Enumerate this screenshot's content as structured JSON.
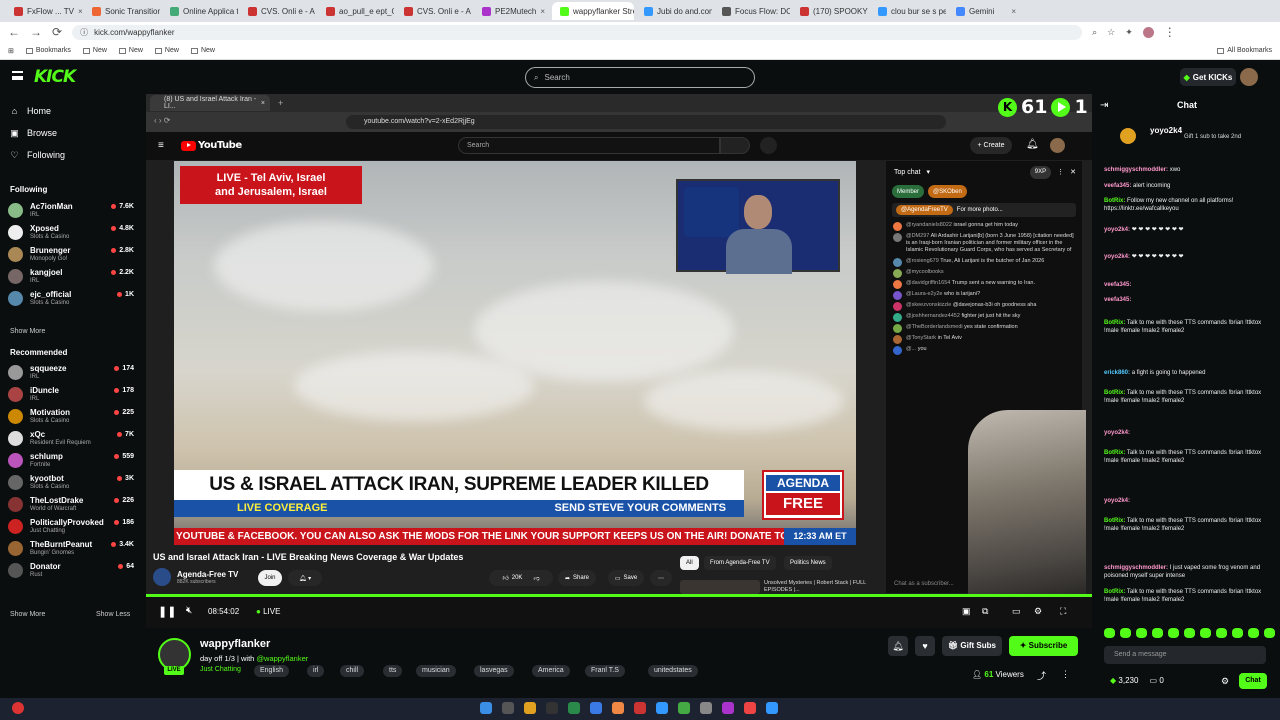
{
  "browser": {
    "tabs": [
      {
        "label": "FxFlow ... TV",
        "color": "#c33"
      },
      {
        "label": "Sonic Transition Cl...",
        "color": "#e63"
      },
      {
        "label": "Online Applica tion",
        "color": "#4a7"
      },
      {
        "label": "CVS. Onli e - A pli ...",
        "color": "#c33"
      },
      {
        "label": "ao_pull_e ept_OD...",
        "color": "#c33"
      },
      {
        "label": "CVS. Onli e - A pli ...",
        "color": "#c33"
      },
      {
        "label": "PE2Mutech",
        "color": "#a3c"
      },
      {
        "label": "wappyflanker Strea...",
        "color": "#53fc18"
      },
      {
        "label": "Jubi do and.com",
        "color": "#39f"
      },
      {
        "label": "Focus Flow: DC | Sm...",
        "color": "#555"
      },
      {
        "label": "(170) SPOOKY 4 ...",
        "color": "#c33"
      },
      {
        "label": "clou bur se s pe",
        "color": "#39f"
      },
      {
        "label": "Gemini",
        "color": "#48f"
      }
    ],
    "url": "kick.com/wappyflanker",
    "bookmarks": [
      "Bookmarks",
      "New",
      "New",
      "New",
      "New",
      "All Bookmarks"
    ]
  },
  "kick": {
    "logo": "KICK",
    "search_placeholder": "Search",
    "get_kicks": "Get KICKs"
  },
  "sidebar": {
    "nav": [
      {
        "label": "Home",
        "icon": "⌂"
      },
      {
        "label": "Browse",
        "icon": "▣"
      },
      {
        "label": "Following",
        "icon": "♡"
      }
    ],
    "following_title": "Following",
    "following": [
      {
        "name": "Ac7ionMan",
        "game": "IRL",
        "viewers": "7.6K",
        "color": "#8b8"
      },
      {
        "name": "Xposed",
        "game": "Slots & Casino",
        "viewers": "4.8K",
        "color": "#eee"
      },
      {
        "name": "Brunenger",
        "game": "Monopoly Go!",
        "viewers": "2.8K",
        "color": "#a85"
      },
      {
        "name": "kangjoel",
        "game": "IRL",
        "viewers": "2.2K",
        "color": "#766"
      },
      {
        "name": "ejc_official",
        "game": "Slots & Casino",
        "viewers": "1K",
        "color": "#58a"
      }
    ],
    "show_more": "Show More",
    "recommended_title": "Recommended",
    "recommended": [
      {
        "name": "sqqueeze",
        "game": "IRL",
        "viewers": "174",
        "color": "#999"
      },
      {
        "name": "iDuncle",
        "game": "IRL",
        "viewers": "178",
        "color": "#a44"
      },
      {
        "name": "Motivation",
        "game": "Slots & Casino",
        "viewers": "225",
        "color": "#c80"
      },
      {
        "name": "xQc",
        "game": "Resident Evil Requiem",
        "viewers": "7K",
        "color": "#ddd"
      },
      {
        "name": "schlump",
        "game": "Fortnite",
        "viewers": "559",
        "color": "#b5b"
      },
      {
        "name": "kyootbot",
        "game": "Slots & Casino",
        "viewers": "3K",
        "color": "#666"
      },
      {
        "name": "TheLostDrake",
        "game": "World of Warcraft",
        "viewers": "226",
        "color": "#833"
      },
      {
        "name": "PoliticallyProvoked",
        "game": "Just Chatting",
        "viewers": "186",
        "color": "#c22"
      },
      {
        "name": "TheBurntPeanut",
        "game": "Bungin' Gnomes",
        "viewers": "3.4K",
        "color": "#963"
      },
      {
        "name": "Donator",
        "game": "Rust",
        "viewers": "64",
        "color": "#555"
      }
    ],
    "show_more_2": "Show More",
    "show_less": "Show Less"
  },
  "inner_browser": {
    "tab": "(8) US and Israel Attack Iran - LI...",
    "url": "youtube.com/watch?v=2-xEd2RjjEg",
    "search_placeholder": "Search",
    "create": "+ Create"
  },
  "stats_overlay": {
    "kick_count": "61",
    "play_count": "1"
  },
  "video": {
    "live_box_line1": "LIVE - Tel Aviv, Israel",
    "live_box_line2": "and Jerusalem, Israel",
    "headline": "US & ISRAEL ATTACK IRAN, SUPREME LEADER KILLED",
    "live_coverage": "LIVE COVERAGE",
    "send_comments": "SEND STEVE YOUR COMMENTS",
    "agenda_top": "AGENDA",
    "agenda_bottom": "FREE",
    "ticker": "YOUTUBE & FACEBOOK. YOU CAN ALSO ASK THE MODS FOR THE LINK     YOUR SUPPORT KEEPS US ON THE AIR! DONATE TO AGE",
    "time": "12:33 AM ET"
  },
  "ytchat": {
    "title": "Top chat",
    "badge": "9XP",
    "member": "Member",
    "pinned": "@AgendaFreeTV",
    "pinned_text": "For more photo...",
    "messages": [
      {
        "user": "@ryandaniels8022",
        "text": "israel gonna get him today",
        "c": "#e74"
      },
      {
        "user": "@DM297",
        "text": "Ali Ardashir Larijani[b] (born 3 June 1958) [citation needed] is an Iraqi-born Iranian politician and former military officer in the Islamic Revolutionary Guard Corps, who has served as Secretary of",
        "c": "#777"
      },
      {
        "user": "@rosieng679",
        "text": "True, Ali Larijani is the butcher of Jan 2026",
        "c": "#58a"
      },
      {
        "user": "@mycoolbooks",
        "text": "",
        "c": "#8a5"
      },
      {
        "user": "@davidgriffin1654",
        "text": "Trump sent a new warning to Iran.",
        "c": "#e74"
      },
      {
        "user": "@Laura-e2y2e",
        "text": "who is larijani?",
        "c": "#75c"
      },
      {
        "user": "@skeezvonskizzle",
        "text": "@davejonas-b3i oh goodness aha",
        "c": "#c36"
      },
      {
        "user": "@joshhernandez4452",
        "text": "fighter jet just hit the sky",
        "c": "#3a8"
      },
      {
        "user": "@TheBorderlandsmedi",
        "text": "yes state confirmation",
        "c": "#7a4"
      },
      {
        "user": "@TonyStark",
        "text": "in Tel Aviv",
        "c": "#a63"
      },
      {
        "user": "@...",
        "text": "you",
        "c": "#36c"
      }
    ],
    "input_placeholder": "Chat as a subscriber..."
  },
  "below_video": {
    "title": "US and Israel Attack Iran - LIVE Breaking News Coverage & War Updates",
    "channel": "Agenda-Free TV",
    "subs": "882K subscribers",
    "join": "Join",
    "likes": "20K",
    "share": "Share",
    "save": "Save",
    "chips": [
      "All",
      "From Agenda-Free TV",
      "Politics News"
    ],
    "rec_title": "Unsolved Mysteries | Robert Stack | FULL EPISODES |..."
  },
  "player": {
    "time": "08:54:02",
    "live": "LIVE"
  },
  "channel": {
    "name": "wappyflanker",
    "title_prefix": "day off 1/3 | with ",
    "title_handle": "@wappyflanker",
    "category": "Just Chatting",
    "tags": [
      "English",
      "irl",
      "chill",
      "tts",
      "musician",
      "lasvegas",
      "America",
      "Franl T.S",
      "unitedstates"
    ],
    "gift_subs": "Gift Subs",
    "subscribe": "Subscribe",
    "viewers_count": "61",
    "viewers_label": "Viewers",
    "live": "LIVE"
  },
  "kchat": {
    "title": "Chat",
    "gift_banner_user": "yoyo2k4",
    "gift_banner_text": "Gift 1 sub to take 2nd",
    "messages": [
      {
        "user": "schmiggyschmoddler:",
        "text": "xwo",
        "color": "#f9c"
      },
      {
        "user": "veefa345:",
        "text": "alert incoming",
        "color": "#f9c"
      },
      {
        "user": "BotRix:",
        "text": "Follow my new channel on all platforms! https://linktr.ee/wafcallkeyou",
        "color": "#53fc18"
      },
      {
        "user": "yoyo2k4:",
        "text": "❤ ❤ ❤ ❤ ❤ ❤ ❤ ❤",
        "color": "#f9c"
      },
      {
        "user": "yoyo2k4:",
        "text": "❤ ❤ ❤ ❤ ❤ ❤ ❤ ❤",
        "color": "#f9c"
      },
      {
        "user": "veefa345:",
        "text": "",
        "color": "#f9c"
      },
      {
        "user": "veefa345:",
        "text": "",
        "color": "#f9c"
      },
      {
        "user": "BotRix:",
        "text": "Talk to me with these TTS commands !brian !ttktox !male !female !male2 !female2",
        "color": "#53fc18"
      },
      {
        "user": "erick860:",
        "text": "a fight is going to happened",
        "color": "#5cf"
      },
      {
        "user": "BotRix:",
        "text": "Talk to me with these TTS commands !brian !ttktox !male !female !male2 !female2",
        "color": "#53fc18"
      },
      {
        "user": "yoyo2k4:",
        "text": "",
        "color": "#f9c"
      },
      {
        "user": "BotRix:",
        "text": "Talk to me with these TTS commands !brian !ttktox !male !female !male2 !female2",
        "color": "#53fc18"
      },
      {
        "user": "yoyo2k4:",
        "text": "",
        "color": "#f9c"
      },
      {
        "user": "BotRix:",
        "text": "Talk to me with these TTS commands !brian !ttktox !male !female !male2 !female2",
        "color": "#53fc18"
      },
      {
        "user": "schmiggyschmoddler:",
        "text": "I just vaped some frog venom and poisoned myself super intense",
        "color": "#f9c"
      },
      {
        "user": "BotRix:",
        "text": "Talk to me with these TTS commands !brian !ttktox !male !female !male2 !female2",
        "color": "#53fc18"
      }
    ],
    "send_placeholder": "Send a message",
    "points": "3,230",
    "zero": "0",
    "chat_button": "Chat"
  }
}
